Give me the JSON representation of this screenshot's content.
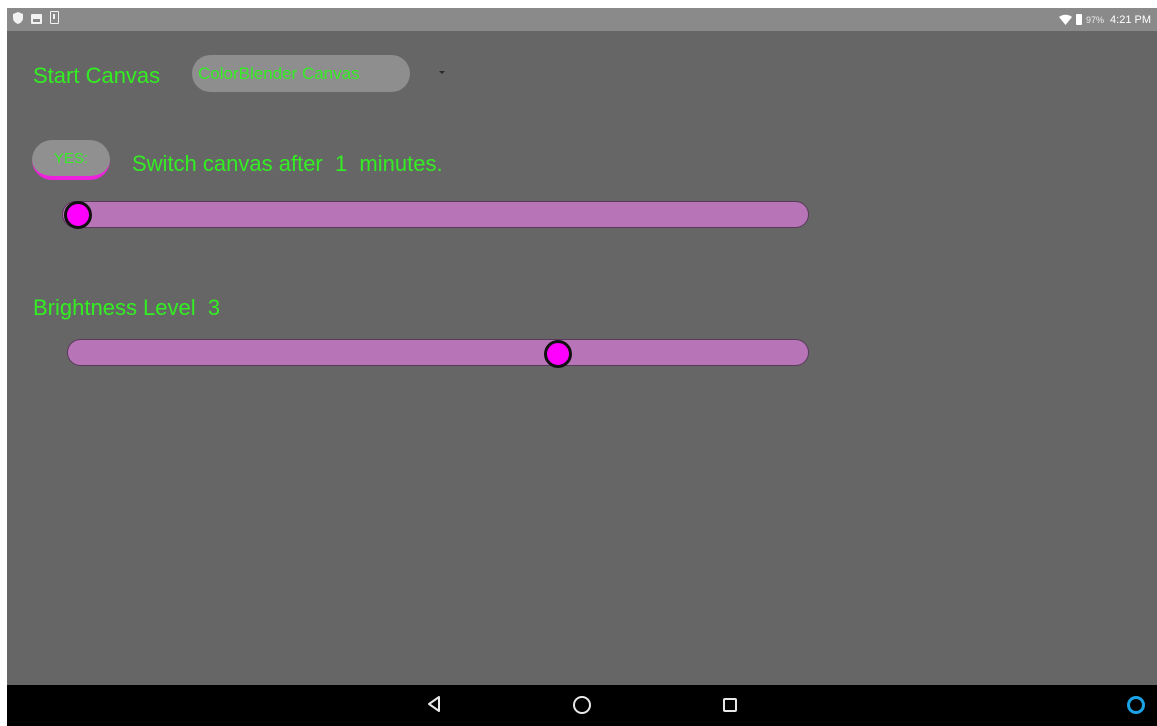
{
  "status_bar": {
    "left_icons": [
      "shield-icon",
      "image-icon",
      "download-icon"
    ],
    "wifi_icon": "wifi-icon",
    "battery_icon": "battery-icon",
    "battery_percent": "97%",
    "time": "4:21 PM"
  },
  "settings": {
    "start_canvas_label": "Start Canvas",
    "start_canvas_value": "ColorBlender Canvas",
    "switch_toggle_label": "YES:",
    "switch_text": "Switch canvas after  1  minutes.",
    "switch_minutes": 1,
    "switch_slider_fraction": 0.0,
    "brightness_label": "Brightness Level  3",
    "brightness_level": 3,
    "brightness_slider_fraction": 0.67
  },
  "nav_bar": {
    "buttons": [
      "back-icon",
      "home-icon",
      "recents-icon"
    ],
    "assistant_icon": "alexa-icon"
  },
  "colors": {
    "text_accent": "#33ee22",
    "slider_track": "#b775b8",
    "slider_thumb": "#ff00ff",
    "toggle_underline": "#ee22dd",
    "background": "#666666"
  }
}
